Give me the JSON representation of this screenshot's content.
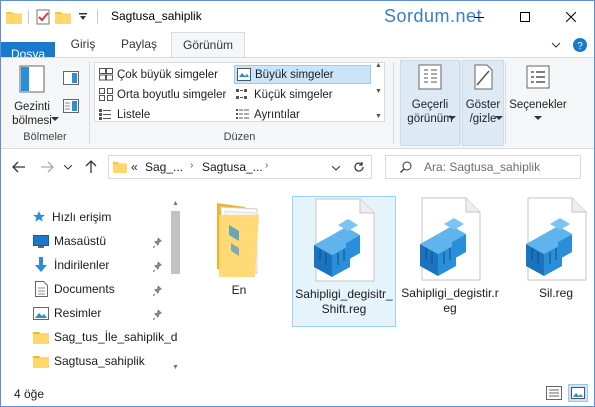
{
  "window": {
    "title": "Sagtusa_sahiplik",
    "watermark": "Sordum.net"
  },
  "qat": {
    "icons": [
      "folder-icon",
      "properties-check-icon",
      "new-folder-icon",
      "customize-qat-icon"
    ]
  },
  "ribbon_tabs": [
    {
      "label": "Dosya"
    },
    {
      "label": "Giriş"
    },
    {
      "label": "Paylaş"
    },
    {
      "label": "Görünüm"
    }
  ],
  "ribbon": {
    "panes": {
      "nav_pane_label_1": "Gezinti",
      "nav_pane_label_2": "bölmesi",
      "group_label": "Bölmeler"
    },
    "layout": {
      "items": [
        {
          "label": "Çok büyük simgeler"
        },
        {
          "label": "Büyük simgeler"
        },
        {
          "label": "Orta boyutlu simgeler"
        },
        {
          "label": "Küçük simgeler"
        },
        {
          "label": "Listele"
        },
        {
          "label": "Ayrıntılar"
        }
      ],
      "group_label": "Düzen"
    },
    "current_view": {
      "label_1": "Geçerli",
      "label_2": "görünüm"
    },
    "show_hide": {
      "label_1": "Göster",
      "label_2": "/gizle"
    },
    "options": {
      "label": "Seçenekler"
    }
  },
  "address": {
    "crumb_overflow": "«",
    "crumbs": [
      "Sag_...",
      "Sagtusa_..."
    ]
  },
  "search": {
    "placeholder": "Ara: Sagtusa_sahiplik"
  },
  "nav_pane": {
    "items": [
      {
        "label": "Hızlı erişim"
      },
      {
        "label": "Masaüstü"
      },
      {
        "label": "İndirilenler"
      },
      {
        "label": "Documents"
      },
      {
        "label": "Resimler"
      },
      {
        "label": "Sag_tus_İle_sahiplik_d"
      },
      {
        "label": "Sagtusa_sahiplik"
      }
    ]
  },
  "files": [
    {
      "name": "En",
      "type": "folder"
    },
    {
      "name": "Sahipligi_degisitr_Shift.reg",
      "type": "reg"
    },
    {
      "name": "Sahipligi_degistir.reg",
      "type": "reg"
    },
    {
      "name": "Sil.reg",
      "type": "reg"
    }
  ],
  "status": {
    "count": "4 öğe"
  },
  "colors": {
    "file_tab": "#1979ca",
    "accent": "#0078d7",
    "reg_blue": "#2a8fd8"
  }
}
